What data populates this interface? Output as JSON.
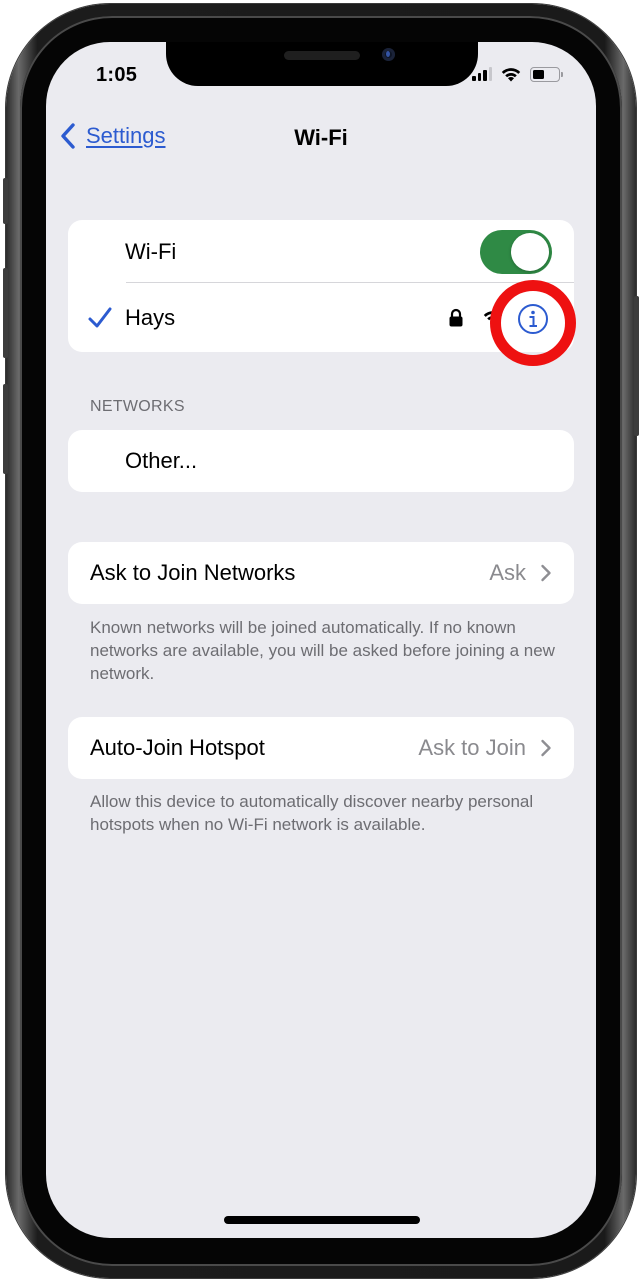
{
  "status_bar": {
    "time": "1:05",
    "signal_bars_active": 3,
    "signal_bars_total": 4,
    "wifi_icon": "wifi-icon",
    "battery_level": 0.45
  },
  "nav": {
    "back_label": "Settings",
    "back_icon": "chevron-left-icon",
    "title": "Wi-Fi"
  },
  "wifi_group": {
    "wifi_toggle_label": "Wi-Fi",
    "wifi_enabled": true,
    "connected_network": {
      "name": "Hays",
      "checkmark_icon": "checkmark-icon",
      "lock_icon": "lock-icon",
      "signal_icon": "wifi-signal-icon",
      "info_icon": "info-icon"
    }
  },
  "networks_section": {
    "header": "NETWORKS",
    "items": [
      {
        "label": "Other..."
      }
    ]
  },
  "ask_to_join": {
    "label": "Ask to Join Networks",
    "value": "Ask",
    "footer": "Known networks will be joined automatically. If no known networks are available, you will be asked before joining a new network."
  },
  "auto_join_hotspot": {
    "label": "Auto-Join Hotspot",
    "value": "Ask to Join",
    "footer": "Allow this device to automatically discover nearby personal hotspots when no Wi-Fi network is available."
  },
  "annotation": {
    "highlight_color": "#ee1111",
    "highlight_target": "info-button"
  },
  "colors": {
    "accent": "#2c5bd0",
    "toggle_on": "#2f8a45",
    "background": "#ebebf0",
    "secondary_text": "#6d6d72"
  }
}
